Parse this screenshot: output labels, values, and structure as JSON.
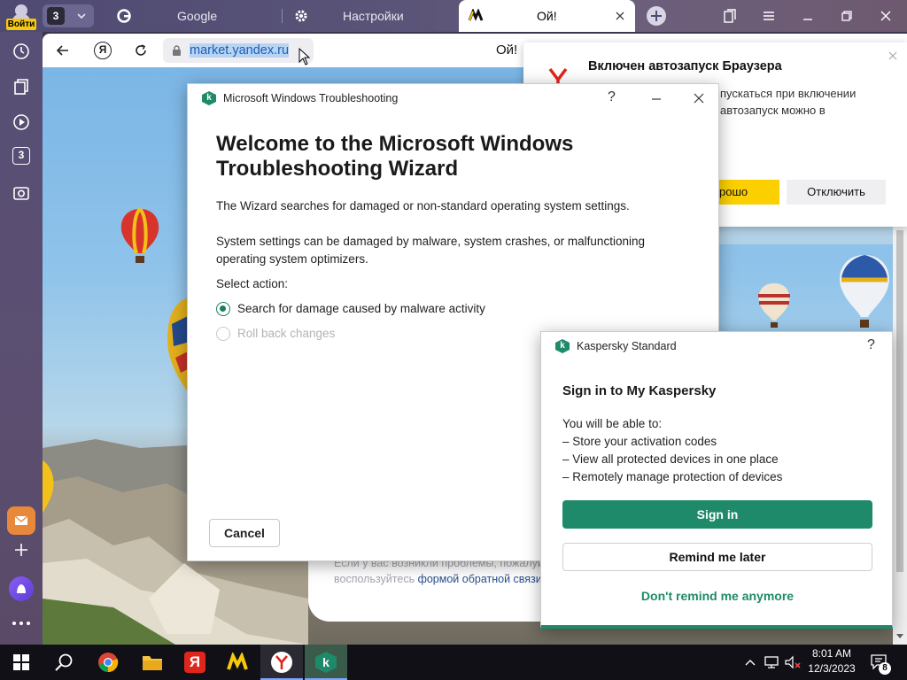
{
  "browser": {
    "tab_count_badge": "3",
    "profile_label": "Войти",
    "tabs": [
      {
        "title": "Google",
        "icon": "google-icon"
      },
      {
        "title": "Настройки",
        "icon": "gear-icon"
      },
      {
        "title": "Ой!",
        "icon": "yandex-market-icon"
      }
    ],
    "address_url": "market.yandex.ru",
    "page_title": "Ой!",
    "sidebar_badge": "3",
    "feedback_text_line1": "Если у вас возникли проблемы, пожалуй",
    "feedback_text_line2": "воспользуйтесь",
    "feedback_link": "формой обратной связи"
  },
  "notification": {
    "title": "Включен автозапуск Браузера",
    "body_line1": "пускаться при включении",
    "body_line2": "автозапуск можно в",
    "ok_label": "рошо",
    "disable_label": "Отключить"
  },
  "wizard": {
    "window_title": "Microsoft Windows Troubleshooting",
    "heading": "Welcome to the Microsoft Windows Troubleshooting Wizard",
    "intro": "The Wizard searches for damaged or non-standard operating system settings.",
    "description": "System settings can be damaged by malware, system crashes, or malfunctioning operating system optimizers.",
    "select_label": "Select action:",
    "options": [
      {
        "label": "Search for damage caused by malware activity",
        "selected": true,
        "enabled": true
      },
      {
        "label": "Roll back changes",
        "selected": false,
        "enabled": false
      }
    ],
    "cancel_label": "Cancel",
    "help_glyph": "?"
  },
  "kaspersky": {
    "window_title": "Kaspersky Standard",
    "heading": "Sign in to My Kaspersky",
    "intro": "You will be able to:",
    "bullets": [
      "– Store your activation codes",
      "– View all protected devices in one place",
      "– Remotely manage protection of devices"
    ],
    "sign_in_label": "Sign in",
    "remind_later_label": "Remind me later",
    "dont_remind_label": "Don't remind me anymore",
    "help_glyph": "?",
    "accent_color": "#1f8a6a"
  },
  "taskbar": {
    "time": "8:01 AM",
    "date": "12/3/2023",
    "notification_count": "8"
  }
}
